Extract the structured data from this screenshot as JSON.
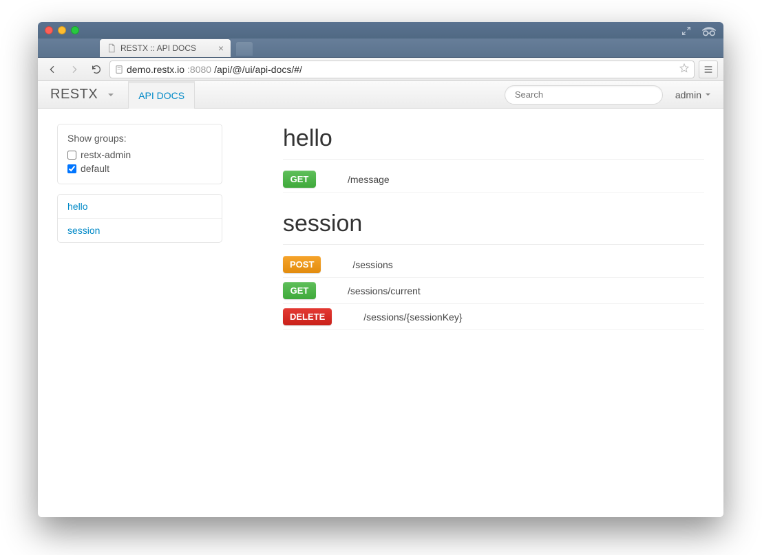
{
  "browser": {
    "tab_title": "RESTX :: API DOCS",
    "url_host": "demo.restx.io",
    "url_port": ":8080",
    "url_path": "/api/@/ui/api-docs/#/"
  },
  "navbar": {
    "brand": "RESTX",
    "active_tab": "API DOCS",
    "search_placeholder": "Search",
    "user": "admin"
  },
  "sidebar": {
    "groups_header": "Show groups:",
    "groups": [
      {
        "label": "restx-admin",
        "checked": false
      },
      {
        "label": "default",
        "checked": true
      }
    ],
    "sections": [
      {
        "label": "hello"
      },
      {
        "label": "session"
      }
    ]
  },
  "api": {
    "groups": [
      {
        "title": "hello",
        "endpoints": [
          {
            "method": "GET",
            "path": "/message"
          }
        ]
      },
      {
        "title": "session",
        "endpoints": [
          {
            "method": "POST",
            "path": "/sessions"
          },
          {
            "method": "GET",
            "path": "/sessions/current"
          },
          {
            "method": "DELETE",
            "path": "/sessions/{sessionKey}"
          }
        ]
      }
    ]
  }
}
